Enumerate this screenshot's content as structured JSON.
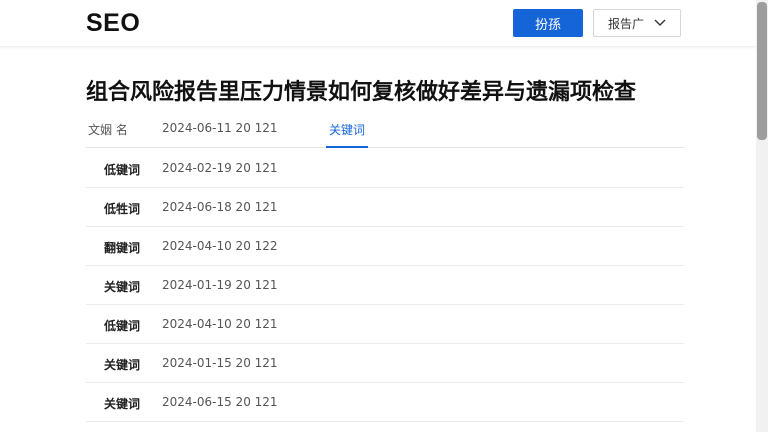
{
  "header": {
    "logo": "SEO",
    "primary_button": "扮孫",
    "dropdown_label": "报告广"
  },
  "article": {
    "title": "组合风险报告里压力情景如何复核做好差异与遗漏项检查"
  },
  "tabs": {
    "col1": "文姻 名",
    "col2": "2024-06-11 20 121",
    "active": "关键词"
  },
  "rows": [
    {
      "keyword": "低键词",
      "date": "2024-02-19 20 121"
    },
    {
      "keyword": "低牲词",
      "date": "2024-06-18 20 121"
    },
    {
      "keyword": "翻键词",
      "date": "2024-04-10 20 122"
    },
    {
      "keyword": "关键词",
      "date": "2024-01-19 20 121"
    },
    {
      "keyword": "低键词",
      "date": "2024-04-10 20 121"
    },
    {
      "keyword": "关键词",
      "date": "2024-01-15 20 121"
    },
    {
      "keyword": "关键词",
      "date": "2024-06-15 20 121"
    }
  ],
  "colors": {
    "accent": "#1565d8"
  },
  "icons": {
    "dropdown": "chevron-down-icon"
  }
}
